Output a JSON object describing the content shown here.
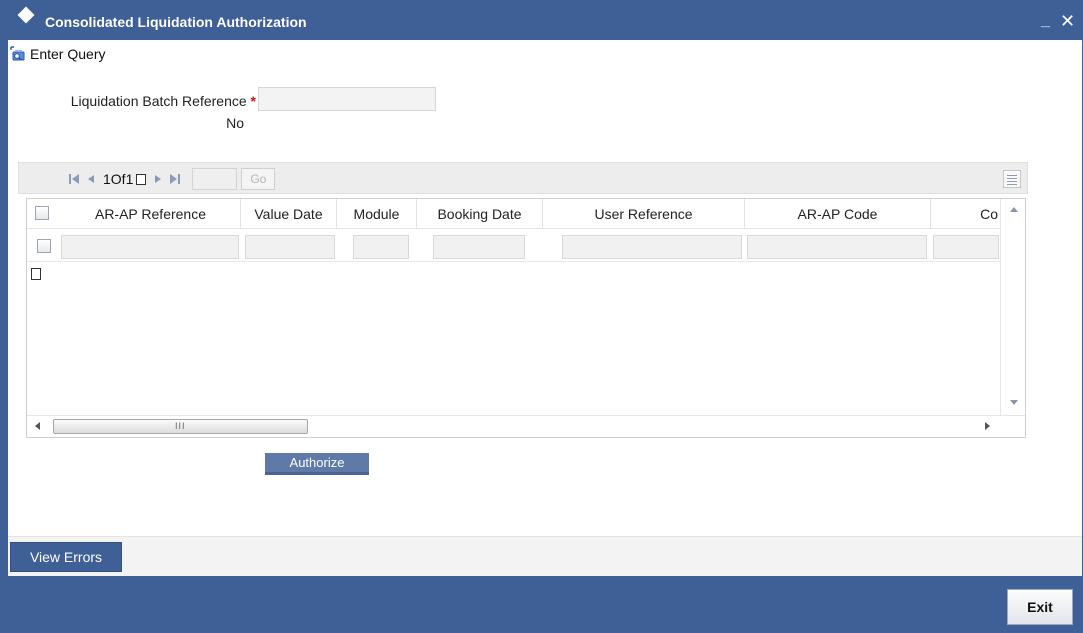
{
  "window": {
    "title": "Consolidated Liquidation Authorization",
    "minimize_glyph": "_",
    "close_glyph": "✕"
  },
  "toolbar": {
    "enter_query_label": "Enter Query",
    "enter_query_icon": "enter-query-icon"
  },
  "form": {
    "batch_ref_label": "Liquidation Batch Reference No",
    "batch_ref_label_line1": "Liquidation Batch Reference",
    "batch_ref_label_line2": "No",
    "required_marker": "*",
    "batch_ref_value": ""
  },
  "pager": {
    "text": "1Of1",
    "page_input_value": "",
    "go_label": "Go"
  },
  "grid": {
    "columns": [
      "AR-AP Reference",
      "Value Date",
      "Module",
      "Booking Date",
      "User Reference",
      "AR-AP Code",
      "Co"
    ],
    "rows": [
      {
        "ar_ap_reference": "",
        "value_date": "",
        "module": "",
        "booking_date": "",
        "user_reference": "",
        "ar_ap_code": "",
        "co": ""
      }
    ],
    "hscroll_grip": "III"
  },
  "actions": {
    "authorize_label": "Authorize",
    "view_errors_label": "View Errors",
    "exit_label": "Exit"
  },
  "colors": {
    "brand_blue": "#3f5f97",
    "button_blue": "#5f79a8",
    "required_red": "#d01010"
  }
}
